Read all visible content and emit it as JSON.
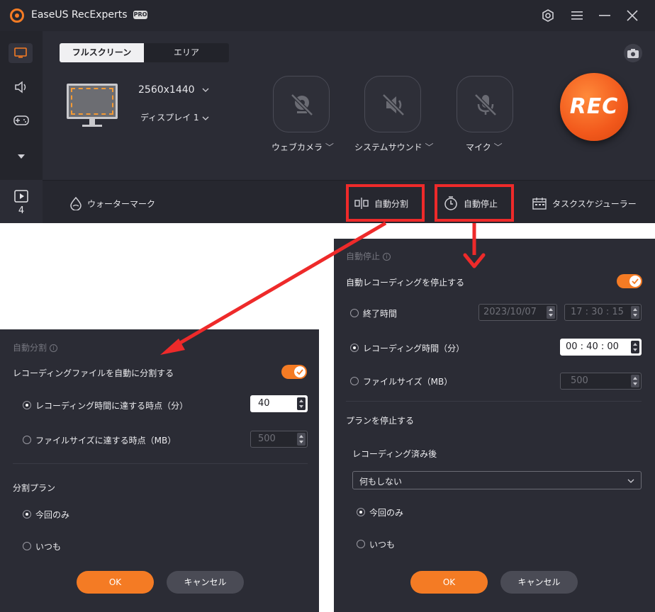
{
  "app": {
    "title": "EaseUS RecExperts",
    "badge": "PRO"
  },
  "sidebar": {
    "recordings_count": "4"
  },
  "mode_tabs": [
    {
      "label": "フルスクリーン",
      "selected": true
    },
    {
      "label": "エリア",
      "selected": false
    }
  ],
  "display": {
    "resolution": "2560x1440",
    "display_name": "ディスプレイ 1"
  },
  "sources": [
    {
      "label": "ウェブカメラ",
      "icon": "webcam-off-icon"
    },
    {
      "label": "システムサウンド",
      "icon": "speaker-muted-icon"
    },
    {
      "label": "マイク",
      "icon": "mic-muted-icon"
    }
  ],
  "rec_label": "REC",
  "bottom_bar": {
    "watermark": "ウォーターマーク",
    "auto_split": "自動分割",
    "auto_stop": "自動停止",
    "scheduler": "タスクスケジューラー"
  },
  "split_dialog": {
    "title": "自動分割",
    "enable_label": "レコーディングファイルを自動に分割する",
    "enabled": true,
    "option_time": "レコーディング時間に達する時点（分）",
    "time_value": "40",
    "option_size": "ファイルサイズに達する時点（MB）",
    "size_value": "500",
    "plan_title": "分割プラン",
    "plan_once": "今回のみ",
    "plan_always": "いつも",
    "ok": "OK",
    "cancel": "キャンセル"
  },
  "stop_dialog": {
    "title": "自動停止",
    "enable_label": "自動レコーディングを停止する",
    "enabled": true,
    "option_end": "終了時間",
    "end_date": "2023/10/07",
    "end_time": "17 : 30 : 15",
    "option_duration": "レコーディング時間（分）",
    "duration_value": "00 : 40 : 00",
    "option_size": "ファイルサイズ（MB）",
    "size_value": "500",
    "plan_title": "プランを停止する",
    "after_label": "レコーディング済み後",
    "after_value": "何もしない",
    "plan_once": "今回のみ",
    "plan_always": "いつも",
    "ok": "OK",
    "cancel": "キャンセル"
  },
  "colors": {
    "accent": "#f47b24",
    "highlight": "#ee2a2a",
    "background": "#2b2c35"
  }
}
